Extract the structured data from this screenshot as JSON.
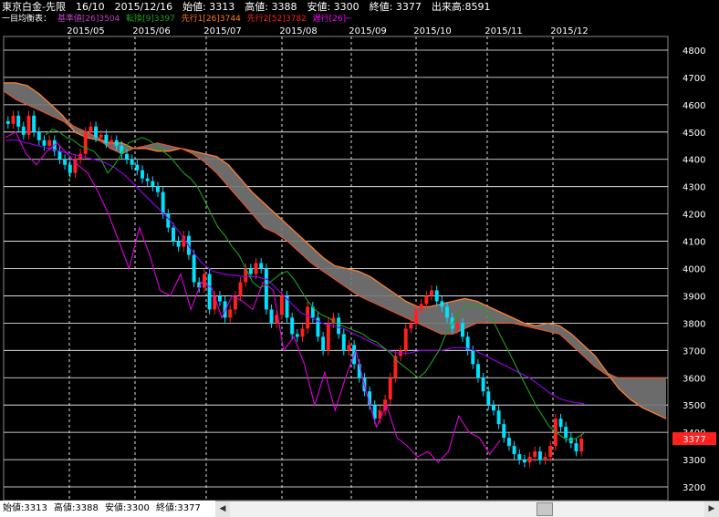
{
  "header": {
    "line1": "東京白金-先限　16/10　2015/12/16　始値: 3313　高値: 3388　安値: 3300　終値: 3377　出来高:8591",
    "prefix": "一目均衡表：",
    "legend": [
      {
        "label": "基準値[26]3504",
        "color": "#c040c0"
      },
      {
        "label": "転換[9]3397",
        "color": "#1fa01f"
      },
      {
        "label": "先行1[26]3744",
        "color": "#ff7a1a"
      },
      {
        "label": "先行2[52]3782",
        "color": "#ff2020"
      },
      {
        "label": "遅行[26]─",
        "color": "#ff00ff"
      }
    ]
  },
  "status": {
    "open": "始値:3313",
    "high": "高値:3388",
    "low": "安値:3300",
    "close": "終値:3377"
  },
  "price_tag": "3377",
  "colors": {
    "up": "#ff2020",
    "down": "#00e0ff",
    "tenkan": "#1fa01f",
    "kijun": "#9000e0",
    "chikou": "#e000e0",
    "span": "#ff8030",
    "cloud": "#777777",
    "grid": "#ffffff"
  },
  "chart_data": {
    "type": "candlestick",
    "title": "東京白金-先限",
    "ylim": [
      3150,
      4850
    ],
    "yticks": [
      3200,
      3300,
      3400,
      3500,
      3600,
      3700,
      3800,
      3900,
      4000,
      4100,
      4200,
      4300,
      4400,
      4500,
      4600,
      4700,
      4800
    ],
    "months": [
      "2015/05",
      "2015/06",
      "2015/07",
      "2015/08",
      "2015/09",
      "2015/10",
      "2015/11",
      "2015/12"
    ],
    "last_close": 3377,
    "close_series": [
      4530,
      4560,
      4520,
      4490,
      4560,
      4500,
      4470,
      4450,
      4470,
      4430,
      4400,
      4380,
      4350,
      4400,
      4420,
      4500,
      4520,
      4480,
      4490,
      4460,
      4470,
      4450,
      4420,
      4400,
      4380,
      4360,
      4330,
      4320,
      4300,
      4280,
      4200,
      4150,
      4100,
      4080,
      4120,
      4050,
      3950,
      3930,
      3980,
      3850,
      3900,
      3880,
      3820,
      3850,
      3900,
      3950,
      4000,
      3980,
      4020,
      4000,
      3850,
      3800,
      3830,
      3900,
      3820,
      3760,
      3750,
      3780,
      3860,
      3820,
      3750,
      3700,
      3800,
      3820,
      3760,
      3700,
      3720,
      3650,
      3600,
      3550,
      3500,
      3450,
      3480,
      3520,
      3600,
      3680,
      3700,
      3780,
      3800,
      3850,
      3870,
      3900,
      3920,
      3880,
      3860,
      3820,
      3780,
      3800,
      3750,
      3700,
      3650,
      3600,
      3550,
      3500,
      3480,
      3430,
      3380,
      3350,
      3320,
      3300,
      3290,
      3310,
      3330,
      3300,
      3310,
      3350,
      3450,
      3420,
      3380,
      3360,
      3330,
      3377
    ],
    "tenkan_series": [
      4490,
      4510,
      4500,
      4480,
      4470,
      4450,
      4440,
      4430,
      4400,
      4350,
      4380,
      4420,
      4460,
      4470,
      4480,
      4470,
      4450,
      4430,
      4410,
      4380,
      4350,
      4330,
      4300,
      4250,
      4200,
      4150,
      4120,
      4080,
      4050,
      4000,
      3950,
      3930,
      3940,
      3960,
      3980,
      3990,
      3960,
      3920,
      3880,
      3850,
      3830,
      3820,
      3800,
      3790,
      3780,
      3770,
      3760,
      3740,
      3730,
      3710,
      3690,
      3660,
      3640,
      3620,
      3600,
      3620,
      3660,
      3700,
      3760,
      3800,
      3840,
      3860,
      3870,
      3860,
      3840,
      3800,
      3750,
      3700,
      3650,
      3600,
      3550,
      3500,
      3460,
      3420,
      3400,
      3380,
      3370,
      3380,
      3397
    ],
    "kijun_series": [
      4470,
      4470,
      4460,
      4450,
      4440,
      4430,
      4420,
      4410,
      4400,
      4390,
      4370,
      4340,
      4300,
      4260,
      4220,
      4180,
      4130,
      4070,
      4020,
      3990,
      3980,
      3975,
      3970,
      3970,
      3960,
      3920,
      3880,
      3840,
      3820,
      3800,
      3790,
      3780,
      3760,
      3740,
      3720,
      3700,
      3690,
      3690,
      3700,
      3700,
      3700,
      3710,
      3710,
      3700,
      3680,
      3660,
      3640,
      3620,
      3600,
      3570,
      3540,
      3520,
      3510,
      3504
    ],
    "chikou_series": [
      4480,
      4500,
      4420,
      4380,
      4430,
      4460,
      4420,
      4380,
      4350,
      4280,
      4200,
      4100,
      4000,
      4150,
      4050,
      3920,
      3900,
      3980,
      3850,
      3950,
      3930,
      3820,
      3900,
      3880,
      3850,
      3950,
      3920,
      3700,
      3750,
      3650,
      3500,
      3620,
      3480,
      3600,
      3700,
      3550,
      3420,
      3500,
      3380,
      3350,
      3310,
      3330,
      3290,
      3330,
      3460,
      3400,
      3380,
      3320,
      3370
    ],
    "span_a_series": [
      4680,
      4680,
      4670,
      4640,
      4600,
      4560,
      4500,
      4480,
      4470,
      4460,
      4460,
      4440,
      4440,
      4430,
      4430,
      4440,
      4430,
      4420,
      4410,
      4380,
      4330,
      4280,
      4240,
      4200,
      4160,
      4120,
      4080,
      4040,
      4010,
      4000,
      3990,
      3970,
      3940,
      3910,
      3880,
      3860,
      3860,
      3870,
      3880,
      3890,
      3880,
      3860,
      3840,
      3820,
      3800,
      3790,
      3800,
      3790,
      3760,
      3720,
      3680,
      3620,
      3560,
      3520,
      3490,
      3470,
      3450
    ],
    "span_b_series": [
      4650,
      4620,
      4600,
      4580,
      4560,
      4540,
      4520,
      4500,
      4480,
      4440,
      4420,
      4440,
      4450,
      4460,
      4450,
      4440,
      4420,
      4390,
      4350,
      4300,
      4250,
      4200,
      4150,
      4130,
      4100,
      4060,
      4020,
      3990,
      3960,
      3930,
      3900,
      3880,
      3860,
      3840,
      3820,
      3800,
      3780,
      3760,
      3760,
      3780,
      3800,
      3800,
      3800,
      3800,
      3790,
      3780,
      3770,
      3760,
      3720,
      3680,
      3640,
      3610,
      3600,
      3600,
      3600,
      3600,
      3600
    ]
  }
}
